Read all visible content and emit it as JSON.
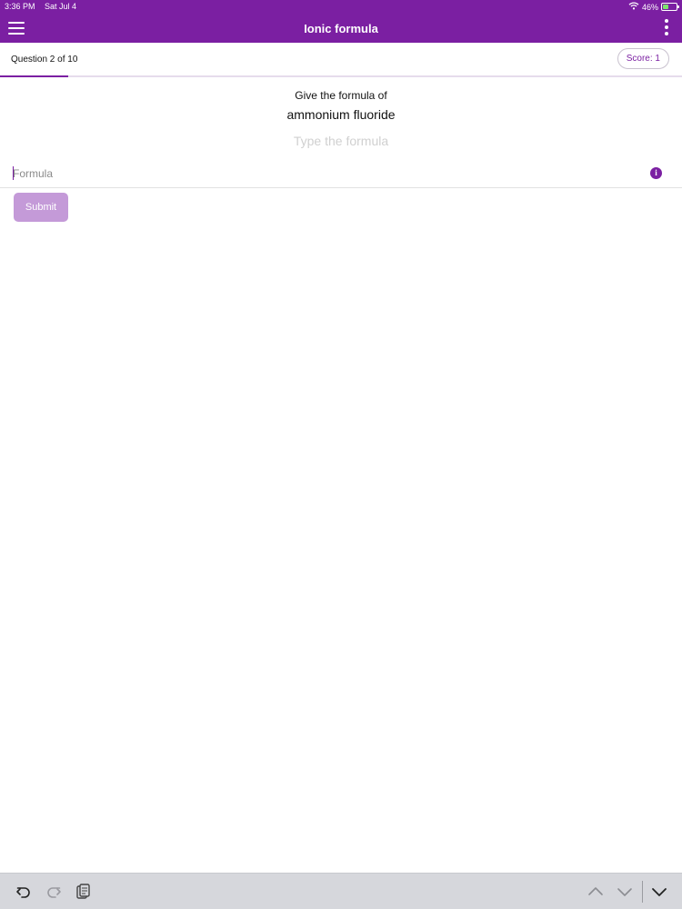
{
  "status_bar": {
    "time": "3:36 PM",
    "date": "Sat Jul 4",
    "battery": "46%",
    "battery_level": 0.46,
    "icons": [
      "wifi-icon",
      "battery-icon"
    ]
  },
  "app_bar": {
    "title": "Ionic formula",
    "icons": [
      "hamburger-menu-icon",
      "more-vertical-icon"
    ]
  },
  "quiz": {
    "question_progress_text": "Question 2 of 10",
    "score_label": "Score: 1",
    "progress": 0.1
  },
  "prompt": {
    "label": "Give the formula of",
    "compound": "ammonium fluoride",
    "hint": "Type the formula"
  },
  "answer": {
    "placeholder": "Formula",
    "value": "",
    "info_icon": "info-icon"
  },
  "submit": {
    "label": "Submit"
  },
  "keyboard_bar": {
    "icons": [
      "undo-icon",
      "redo-icon",
      "paste-icon",
      "chevron-up-icon",
      "chevron-down-icon",
      "dismiss-keyboard-icon"
    ]
  },
  "colors": {
    "brand": "#7b1fa2",
    "submit_disabled": "#c49ad8",
    "hint": "#d0d0d0"
  }
}
